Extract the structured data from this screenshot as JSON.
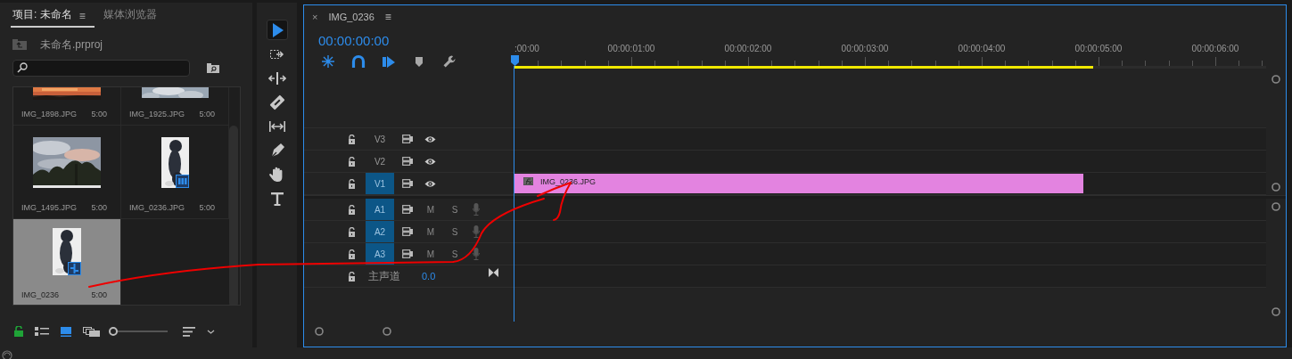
{
  "project_panel": {
    "tabs": [
      {
        "label": "项目: 未命名",
        "selected": true,
        "menu": "≡"
      },
      {
        "label": "媒体浏览器",
        "selected": false
      }
    ],
    "file_name": "未命名.prproj",
    "items": [
      {
        "name": "IMG_1898.JPG",
        "duration": "5:00",
        "selected": false
      },
      {
        "name": "IMG_1925.JPG",
        "duration": "5:00",
        "selected": false
      },
      {
        "name": "IMG_1495.JPG",
        "duration": "5:00",
        "selected": false
      },
      {
        "name": "IMG_0236.JPG",
        "duration": "5:00",
        "selected": false,
        "kind": "clip"
      },
      {
        "name": "IMG_0236",
        "duration": "5:00",
        "selected": true,
        "kind": "sequence"
      }
    ],
    "footer_tools": [
      {
        "kind": "lock"
      },
      {
        "kind": "list_view",
        "selected": false
      },
      {
        "kind": "icon_view",
        "selected": true
      },
      {
        "kind": "freeform_view",
        "selected": false
      },
      {
        "kind": "zoom",
        "level": 0
      },
      {
        "kind": "sort"
      },
      {
        "kind": "chevron"
      }
    ]
  },
  "tools": [
    {
      "kind": "selection",
      "selected": true
    },
    {
      "kind": "track_select",
      "selected": false
    },
    {
      "kind": "ripple",
      "selected": false
    },
    {
      "kind": "razor",
      "selected": false
    },
    {
      "kind": "slip",
      "selected": false
    },
    {
      "kind": "pen",
      "selected": false
    },
    {
      "kind": "hand",
      "selected": false
    },
    {
      "kind": "type",
      "selected": false
    }
  ],
  "timeline": {
    "tab": {
      "close": "×",
      "title": "IMG_0236",
      "menu": "≡"
    },
    "timecode": "00:00:00:00",
    "toolbar": [
      {
        "kind": "nest",
        "on": true
      },
      {
        "kind": "snap",
        "on": true
      },
      {
        "kind": "linked",
        "on": true
      },
      {
        "kind": "marker",
        "on": false
      },
      {
        "kind": "settings",
        "on": false
      }
    ],
    "ruler_labels": [
      ":00:00",
      "00:00:01:00",
      "00:00:02:00",
      "00:00:03:00",
      "00:00:04:00",
      "00:00:05:00",
      "00:00:06:00"
    ],
    "work_area": {
      "level": 0.77
    },
    "video_tracks": [
      {
        "label": "V3",
        "targeted": false
      },
      {
        "label": "V2",
        "targeted": false
      },
      {
        "label": "V1",
        "targeted": true,
        "clips": [
          {
            "name": "IMG_0236.JPG",
            "level": 0.757
          }
        ]
      }
    ],
    "audio_tracks": [
      {
        "label": "A1",
        "targeted": true,
        "mute": "M",
        "solo": "S"
      },
      {
        "label": "A2",
        "targeted": true,
        "mute": "M",
        "solo": "S"
      },
      {
        "label": "A3",
        "targeted": true,
        "mute": "M",
        "solo": "S"
      }
    ],
    "master": {
      "label": "主声道",
      "value": "0.0"
    }
  },
  "annotation": {
    "kind": "arrow"
  }
}
